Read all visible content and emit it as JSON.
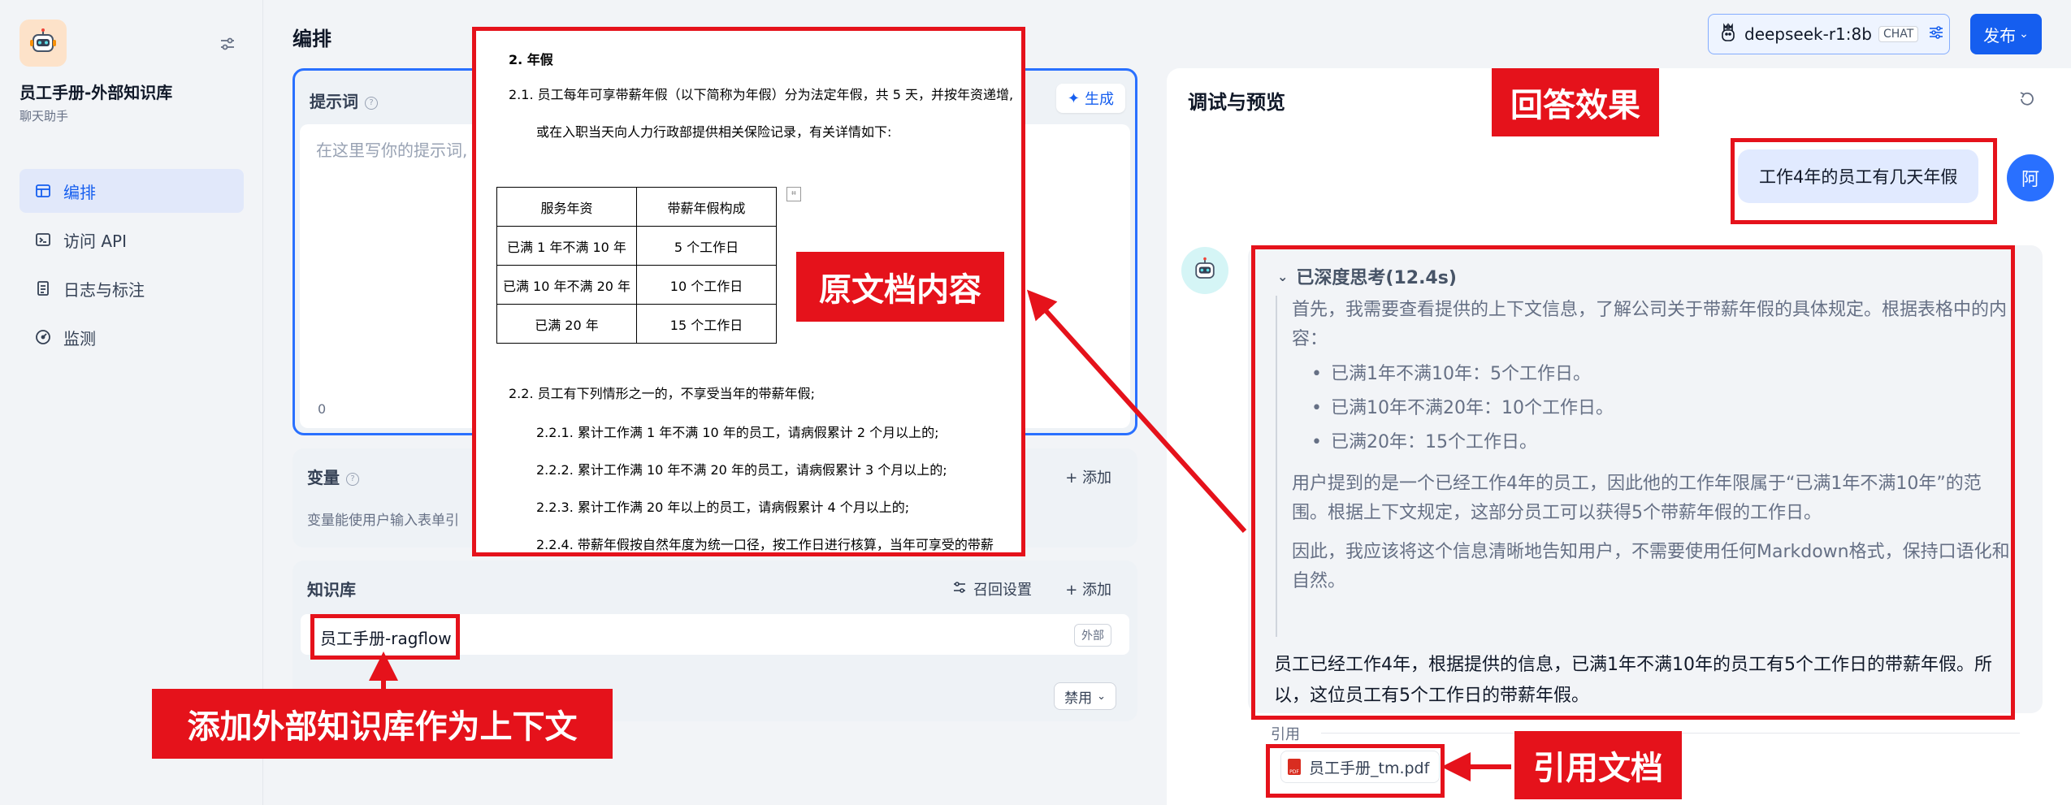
{
  "sidebar": {
    "app_title": "员工手册-外部知识库",
    "app_subtitle": "聊天助手",
    "items": [
      {
        "label": "编排",
        "icon": "layout-icon",
        "active": true
      },
      {
        "label": "访问 API",
        "icon": "terminal-icon",
        "active": false
      },
      {
        "label": "日志与标注",
        "icon": "log-icon",
        "active": false
      },
      {
        "label": "监测",
        "icon": "monitor-icon",
        "active": false
      }
    ]
  },
  "main": {
    "title": "编排",
    "prompt": {
      "label": "提示词",
      "generate_label": "生成",
      "placeholder": "在这里写你的提示词,",
      "count": "0"
    },
    "variables": {
      "label": "变量",
      "add_label": "添加",
      "description": "变量能使用户输入表单引"
    },
    "knowledge": {
      "label": "知识库",
      "recall_label": "召回设置",
      "add_label": "添加",
      "item_name": "员工手册-ragflow",
      "item_tag": "外部",
      "disable_label": "禁用"
    }
  },
  "document": {
    "heading": "2.   年假",
    "p1_line1": "2.1. 员工每年可享带薪年假（以下简称为年假）分为法定年假，共 5 天，并按年资递增,",
    "p1_line2": "或在入职当天向人力行政部提供相关保险记录，有关详情如下:",
    "table_headers": [
      "服务年资",
      "带薪年假构成"
    ],
    "table_rows": [
      [
        "已满 1 年不满 10 年",
        "5 个工作日"
      ],
      [
        "已满 10 年不满 20 年",
        "10 个工作日"
      ],
      [
        "已满 20 年",
        "15 个工作日"
      ]
    ],
    "p2": "2.2. 员工有下列情形之一的，不享受当年的带薪年假;",
    "sub_items": [
      "2.2.1.     累计工作满 1 年不满 10 年的员工，请病假累计 2 个月以上的;",
      "2.2.2.     累计工作满 10 年不满 20 年的员工，请病假累计 3 个月以上的;",
      "2.2.3.     累计工作满 20 年以上的员工，请病假累计 4 个月以上的;",
      "2.2.4.     带薪年假按自然年度为统一口径，按工作日进行核算，当年可享受的带薪"
    ]
  },
  "header": {
    "model_name": "deepseek-r1:8b",
    "model_tag": "CHAT",
    "publish_label": "发布"
  },
  "preview": {
    "title": "调试与预览",
    "user_message": "工作4年的员工有几天年假",
    "user_avatar": "阿",
    "think_title": "已深度思考(12.4s)",
    "think_p1": "首先，我需要查看提供的上下文信息，了解公司关于带薪年假的具体规定。根据表格中的内容：",
    "think_list": [
      "已满1年不满10年：5个工作日。",
      "已满10年不满20年：10个工作日。",
      "已满20年：15个工作日。"
    ],
    "think_p2": "用户提到的是一个已经工作4年的员工，因此他的工作年限属于“已满1年不满10年”的范围。根据上下文规定，这部分员工可以获得5个带薪年假的工作日。",
    "think_p3": "因此，我应该将这个信息清晰地告知用户，不需要使用任何Markdown格式，保持口语化和自然。",
    "final_answer": "员工已经工作4年，根据提供的信息，已满1年不满10年的员工有5个工作日的带薪年假。所以，这位员工有5个工作日的带薪年假。",
    "citation_label": "引用",
    "citation_file": "员工手册_tm.pdf"
  },
  "annotations": {
    "doc_label": "原文档内容",
    "answer_label": "回答效果",
    "kb_label": "添加外部知识库作为上下文",
    "cite_label": "引用文档",
    "color": "#e5121b"
  }
}
